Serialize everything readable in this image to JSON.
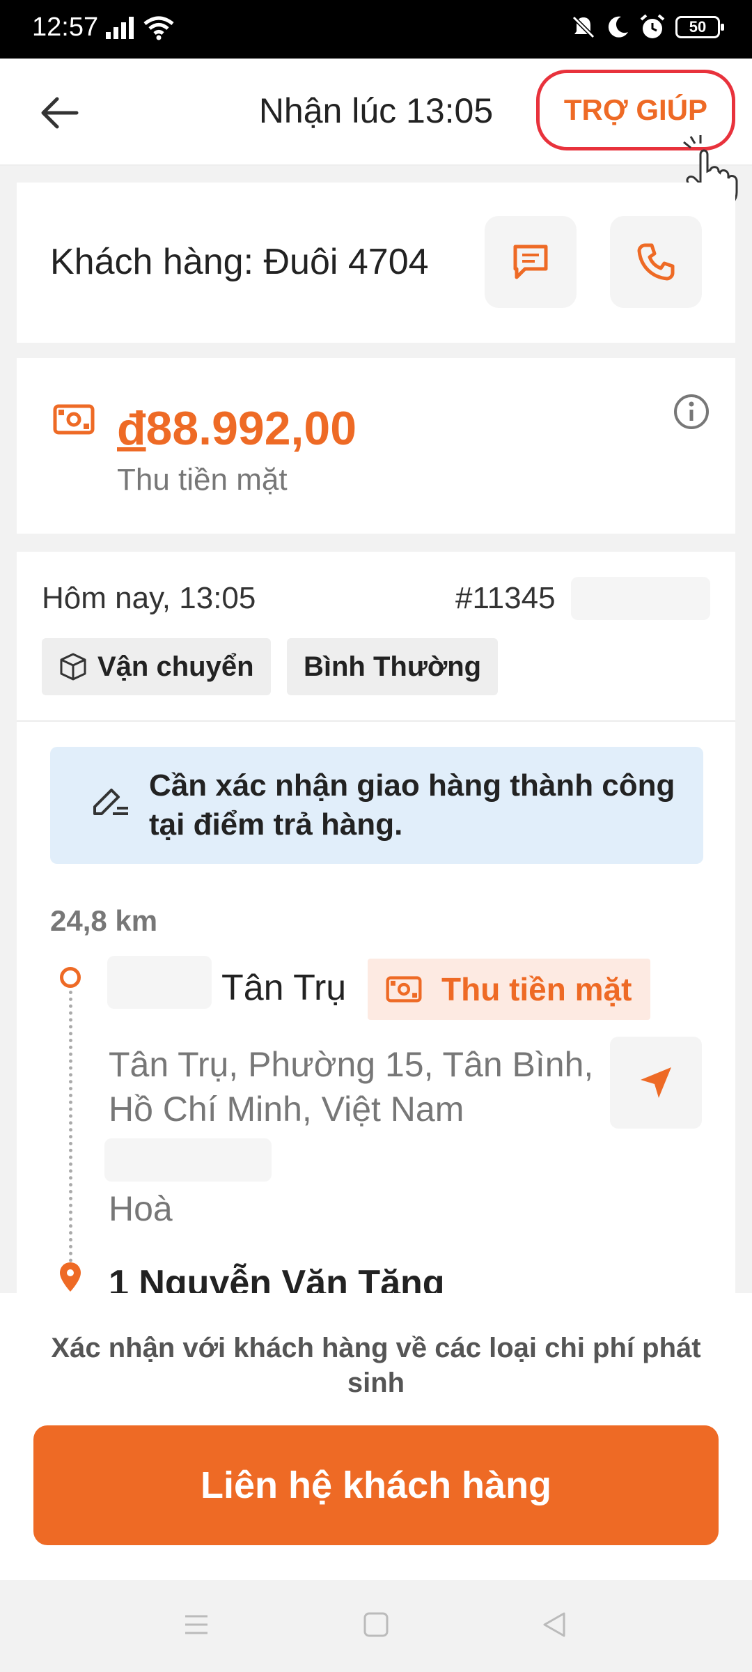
{
  "status_bar": {
    "time": "12:57",
    "battery": "50"
  },
  "header": {
    "title": "Nhận lúc 13:05",
    "help_label": "TRỢ GIÚP"
  },
  "customer": {
    "label": "Khách hàng: Đuôi 4704"
  },
  "payment": {
    "currency_symbol": "đ",
    "amount": "88.992,00",
    "method": "Thu tiền mặt"
  },
  "order": {
    "date": "Hôm nay, 13:05",
    "id": "#11345",
    "tags": [
      "Vận chuyển",
      "Bình Thường"
    ],
    "notice": "Cần xác nhận giao hàng thành công tại điểm trả hàng.",
    "distance": "24,8 km",
    "pickup": {
      "name": "Tân Trụ",
      "cash_tag": "Thu tiền mặt",
      "address": "Tân Trụ, Phường 15, Tân Bình, Hồ Chí Minh, Việt Nam",
      "ward": "Hoà"
    },
    "dropoff": {
      "name": "1 Nguyễn Văn Tăng"
    }
  },
  "bottom": {
    "warning": "Xác nhận với khách hàng về các loại chi phí phát sinh",
    "cta": "Liên hệ khách hàng"
  },
  "colors": {
    "accent": "#ee6a25",
    "highlight_ring": "#e8323c",
    "notice_bg": "#e1eefa"
  }
}
